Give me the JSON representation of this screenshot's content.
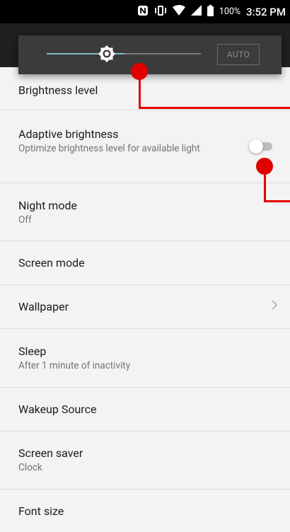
{
  "status_bar": {
    "battery_percent": "100%",
    "time": "3:52 PM",
    "icons": [
      "nfc-icon",
      "vibrate-icon",
      "wifi-icon",
      "signal-icon",
      "battery-icon"
    ]
  },
  "brightness_dialog": {
    "auto_label": "AUTO",
    "level_fraction": 0.5,
    "accent_color": "#7cc0c6"
  },
  "settings": {
    "brightness_level": {
      "title": "Brightness level"
    },
    "adaptive_brightness": {
      "title": "Adaptive brightness",
      "subtitle": "Optimize brightness level for available light",
      "enabled": false
    },
    "night_mode": {
      "title": "Night mode",
      "subtitle": "Off"
    },
    "screen_mode": {
      "title": "Screen mode"
    },
    "wallpaper": {
      "title": "Wallpaper"
    },
    "sleep": {
      "title": "Sleep",
      "subtitle": "After 1 minute of inactivity"
    },
    "wakeup_source": {
      "title": "Wakeup Source"
    },
    "screen_saver": {
      "title": "Screen saver",
      "subtitle": "Clock"
    },
    "font_size": {
      "title": "Font size"
    }
  },
  "annotation_color": "#e10000"
}
